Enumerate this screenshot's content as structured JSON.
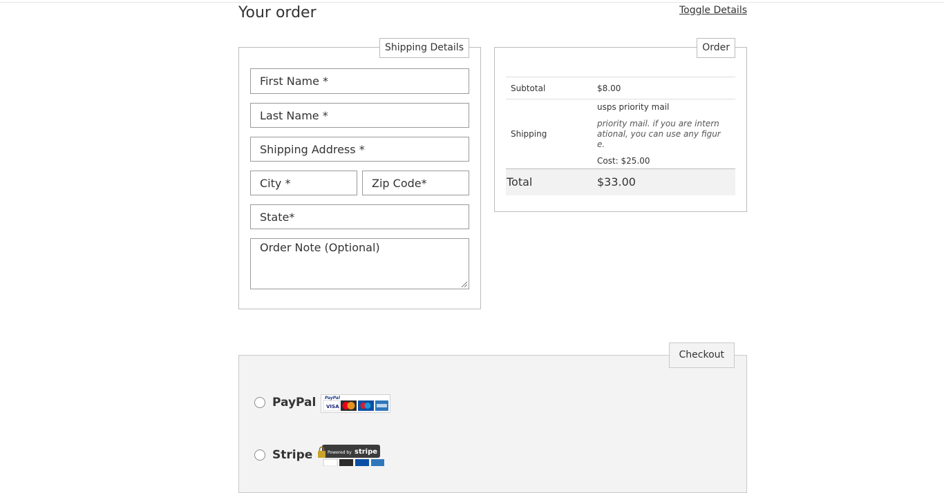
{
  "header": {
    "title": "Your order",
    "toggle_label": "Toggle Details"
  },
  "shipping": {
    "legend": "Shipping Details",
    "fields": {
      "first_name": "First Name *",
      "last_name": "Last Name *",
      "address": "Shipping Address *",
      "city": "City *",
      "zip": "Zip Code*",
      "state": "State*",
      "note": "Order Note (Optional)"
    }
  },
  "order": {
    "legend": "Order",
    "subtotal_label": "Subtotal",
    "subtotal_value": "$8.00",
    "shipping_label": "Shipping",
    "shipping_method": "usps priority mail",
    "shipping_note": "priority mail. if you are international, you can use any figure.",
    "shipping_cost": "Cost: $25.00",
    "total_label": "Total",
    "total_value": "$33.00"
  },
  "checkout": {
    "legend": "Checkout",
    "options": [
      {
        "label": "PayPal",
        "selected": false,
        "logo_icon": "paypal-cards-icon",
        "logo_brand": "PayPal",
        "cards": [
          "VISA",
          "MasterCard",
          "Maestro",
          "American Express"
        ]
      },
      {
        "label": "Stripe",
        "selected": false,
        "logo_icon": "powered-by-stripe-icon",
        "logo_text": "Powered by",
        "logo_brand": "stripe"
      }
    ]
  },
  "colors": {
    "text": "#333333",
    "border": "#bbbbbb",
    "checkout_bg": "#f3f3f3",
    "total_bg": "#f2f2f2"
  }
}
